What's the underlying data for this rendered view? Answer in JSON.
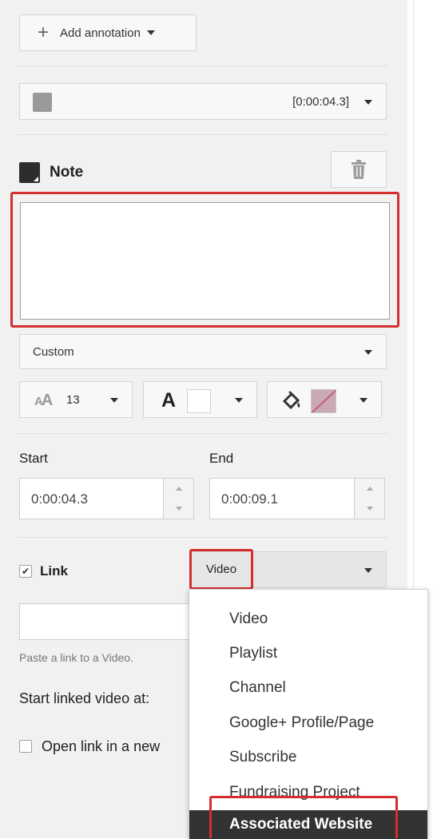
{
  "toolbar": {
    "add_annotation_label": "Add annotation"
  },
  "annotation_selector": {
    "timestamp": "[0:00:04.3]"
  },
  "note": {
    "heading": "Note",
    "text": ""
  },
  "style_select": {
    "value": "Custom"
  },
  "format": {
    "font_size": "13",
    "text_icon": "A"
  },
  "timing": {
    "start_label": "Start",
    "start_value": "0:00:04.3",
    "end_label": "End",
    "end_value": "0:00:09.1"
  },
  "link": {
    "label": "Link",
    "checked": true,
    "type_value": "Video",
    "url_value": "",
    "hint": "Paste a link to a Video.",
    "start_linked_label": "Start linked video at:",
    "open_new_label": "Open link in a new"
  },
  "dropdown": {
    "items": [
      "Video",
      "Playlist",
      "Channel",
      "Google+ Profile/Page",
      "Subscribe",
      "Fundraising Project",
      "Associated Website"
    ],
    "highlighted": "Associated Website"
  },
  "colors": {
    "highlight_red": "#d32f2f",
    "menu_highlight_bg": "#333333"
  }
}
